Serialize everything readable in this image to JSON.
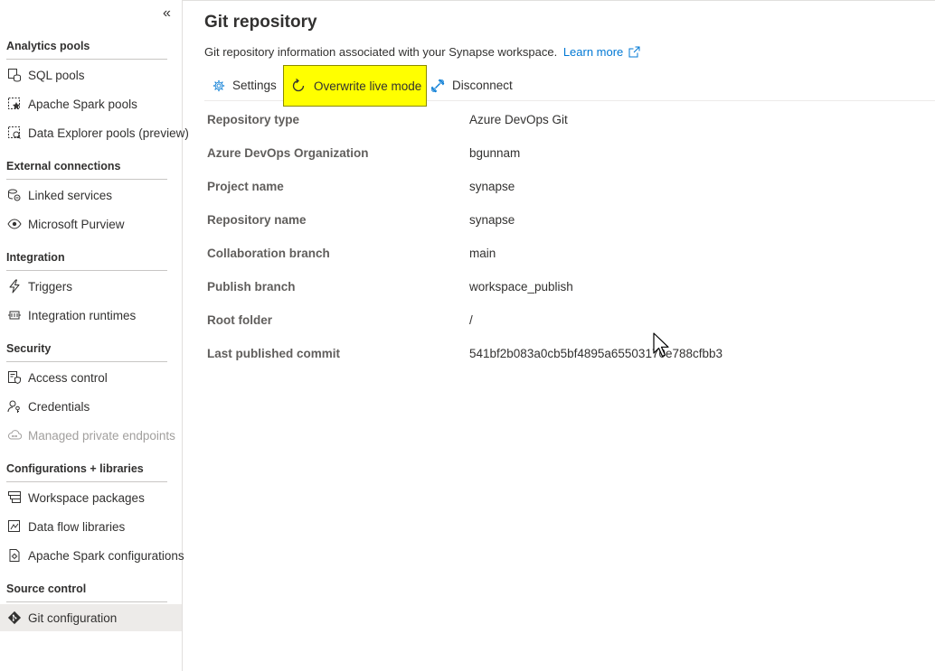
{
  "sidebar": {
    "collapse_glyph": "«",
    "sections": [
      {
        "title": "Analytics pools",
        "items": [
          {
            "label": "SQL pools",
            "icon": "sql-pools-icon"
          },
          {
            "label": "Apache Spark pools",
            "icon": "spark-pools-icon"
          },
          {
            "label": "Data Explorer pools (preview)",
            "icon": "data-explorer-icon"
          }
        ]
      },
      {
        "title": "External connections",
        "items": [
          {
            "label": "Linked services",
            "icon": "linked-services-icon"
          },
          {
            "label": "Microsoft Purview",
            "icon": "purview-icon"
          }
        ]
      },
      {
        "title": "Integration",
        "items": [
          {
            "label": "Triggers",
            "icon": "trigger-icon"
          },
          {
            "label": "Integration runtimes",
            "icon": "integration-runtime-icon"
          }
        ]
      },
      {
        "title": "Security",
        "items": [
          {
            "label": "Access control",
            "icon": "access-control-icon"
          },
          {
            "label": "Credentials",
            "icon": "credentials-icon"
          },
          {
            "label": "Managed private endpoints",
            "icon": "private-endpoint-icon",
            "disabled": true
          }
        ]
      },
      {
        "title": "Configurations + libraries",
        "items": [
          {
            "label": "Workspace packages",
            "icon": "packages-icon"
          },
          {
            "label": "Data flow libraries",
            "icon": "dataflow-libraries-icon"
          },
          {
            "label": "Apache Spark configurations",
            "icon": "spark-config-icon"
          }
        ]
      },
      {
        "title": "Source control",
        "items": [
          {
            "label": "Git configuration",
            "icon": "git-icon",
            "active": true
          }
        ]
      }
    ]
  },
  "main": {
    "title": "Git repository",
    "description": "Git repository information associated with your Synapse workspace.",
    "learn_more": "Learn more",
    "toolbar": {
      "settings": "Settings",
      "overwrite": "Overwrite live mode",
      "disconnect": "Disconnect"
    },
    "properties": [
      {
        "label": "Repository type",
        "value": "Azure DevOps Git"
      },
      {
        "label": "Azure DevOps Organization",
        "value": "bgunnam"
      },
      {
        "label": "Project name",
        "value": "synapse"
      },
      {
        "label": "Repository name",
        "value": "synapse"
      },
      {
        "label": "Collaboration branch",
        "value": "main"
      },
      {
        "label": "Publish branch",
        "value": "workspace_publish"
      },
      {
        "label": "Root folder",
        "value": "/"
      },
      {
        "label": "Last published commit",
        "value": "541bf2b083a0cb5bf4895a65503170e788cfbb3"
      }
    ]
  },
  "colors": {
    "accent": "#0078d4",
    "highlight": "#ffff00",
    "active_bg": "#edebe9"
  }
}
